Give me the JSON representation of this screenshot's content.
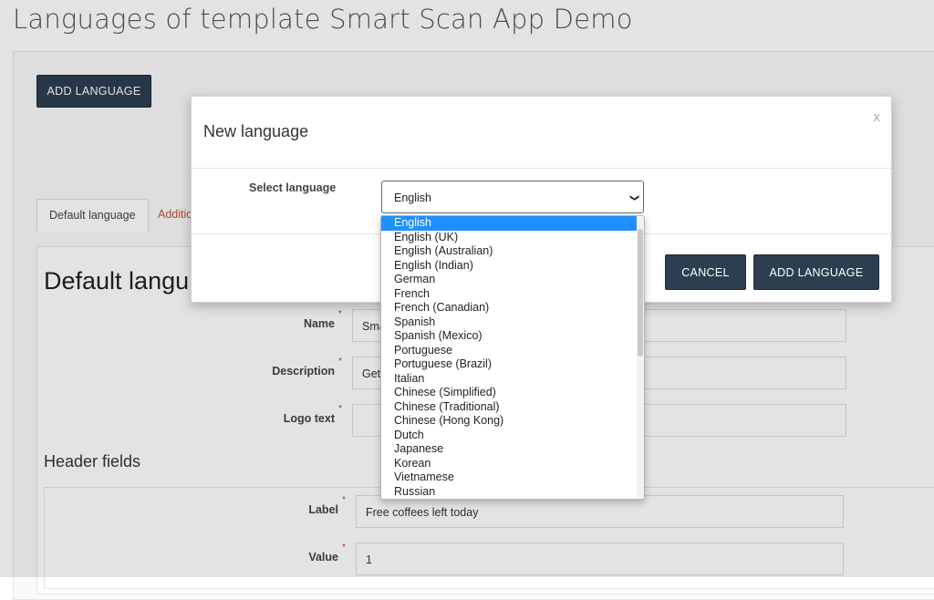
{
  "page": {
    "title": "Languages of template Smart Scan App Demo"
  },
  "toolbar": {
    "add_language_label": "ADD LANGUAGE"
  },
  "tabs": [
    {
      "label": "Default language"
    },
    {
      "label": "Additio"
    }
  ],
  "main": {
    "section_title": "Default langu",
    "fields": {
      "name": {
        "label": "Name",
        "value": "Sma"
      },
      "description": {
        "label": "Description",
        "value": "Get"
      },
      "logo_text": {
        "label": "Logo text",
        "value": ""
      }
    },
    "header_fields": {
      "title": "Header fields",
      "label": {
        "label": "Label",
        "value": "Free coffees left today"
      },
      "value": {
        "label": "Value",
        "value": "1"
      }
    }
  },
  "modal": {
    "title": "New language",
    "close_label": "x",
    "select_label": "Select language",
    "selected_value": "English",
    "cancel_label": "CANCEL",
    "add_label": "ADD LANGUAGE",
    "options": [
      "English",
      "English (UK)",
      "English (Australian)",
      "English (Indian)",
      "German",
      "French",
      "French (Canadian)",
      "Spanish",
      "Spanish (Mexico)",
      "Portuguese",
      "Portuguese (Brazil)",
      "Italian",
      "Chinese (Simplified)",
      "Chinese (Traditional)",
      "Chinese (Hong Kong)",
      "Dutch",
      "Japanese",
      "Korean",
      "Vietnamese",
      "Russian"
    ]
  },
  "colors": {
    "primary_button": "#2d3e50",
    "selected_option": "#1e90ff",
    "required_marker": "#c0392b",
    "tab_link": "#c0572f"
  }
}
